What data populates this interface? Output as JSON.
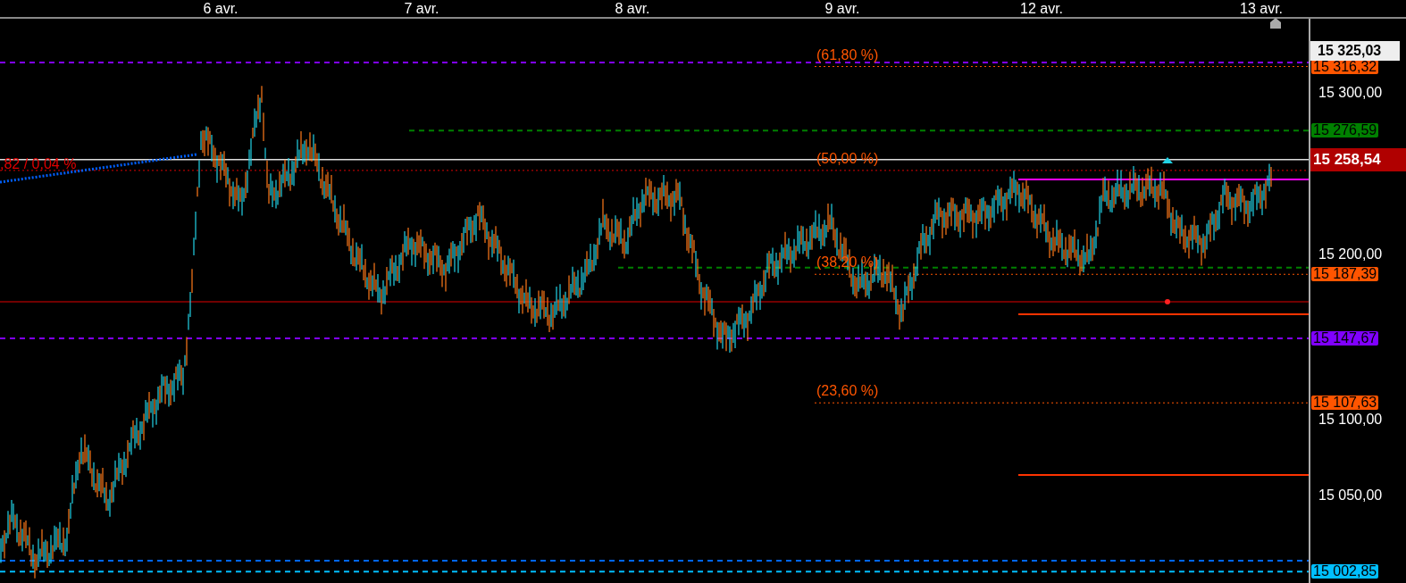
{
  "time_axis": {
    "labels": [
      "6 avr.",
      "7 avr.",
      "8 avr.",
      "9 avr.",
      "12 avr.",
      "13 avr."
    ]
  },
  "price_axis": {
    "labels": [
      "15 300,00",
      "15 200,00",
      "15 100,00",
      "15 050,00"
    ]
  },
  "high_badge": "15 325,03",
  "last_price": "15 258,54",
  "left_annotation": ",82 / 0,04 %",
  "fibonacci": [
    {
      "label": "(61,80 %)",
      "badge": "15 316,32"
    },
    {
      "label": "(50,00 %)"
    },
    {
      "label": "(38,20 %)",
      "badge": "15 187,39"
    },
    {
      "label": "(23,60 %)",
      "badge": "15 107,63"
    }
  ],
  "levels": [
    {
      "badge": "15 276,59",
      "color": "#008000",
      "kind": "dashed"
    },
    {
      "badge": "15 147,67",
      "color": "#8000ff",
      "kind": "dashed"
    },
    {
      "badge": "15 002,85",
      "color": "#00bfff",
      "kind": "dashed"
    }
  ]
}
